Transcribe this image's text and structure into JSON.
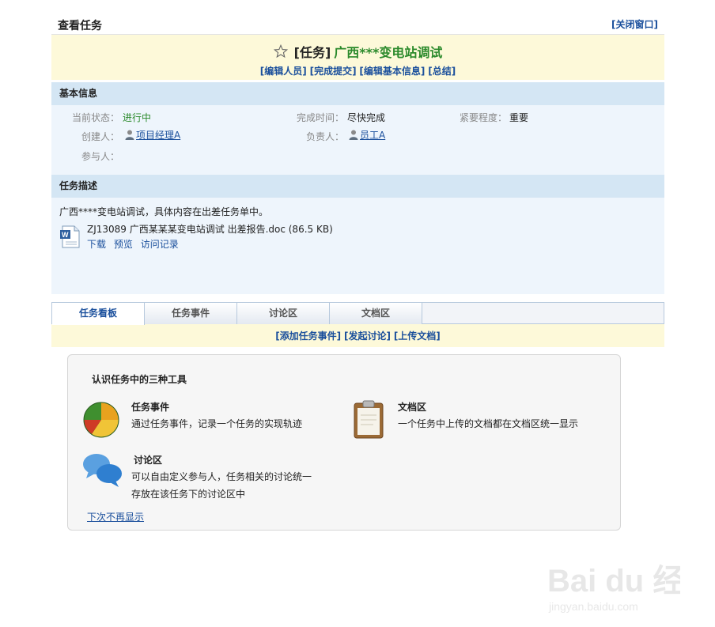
{
  "header": {
    "title": "查看任务",
    "close_label": "[关闭窗口]"
  },
  "task": {
    "type_label": "[任务]",
    "name": "广西***变电站调试",
    "actions": [
      "[编辑人员]",
      "[完成提交]",
      "[编辑基本信息]",
      "[总结]"
    ]
  },
  "basic_info": {
    "heading": "基本信息",
    "status_label": "当前状态：",
    "status_value": "进行中",
    "complete_label": "完成时间：",
    "complete_value": "尽快完成",
    "urgency_label": "紧要程度：",
    "urgency_value": "重要",
    "creator_label": "创建人：",
    "creator_value": "项目经理A",
    "owner_label": "负责人：",
    "owner_value": "员工A",
    "participants_label": "参与人："
  },
  "description": {
    "heading": "任务描述",
    "text": "广西****变电站调试，具体内容在出差任务单中。",
    "file_name": "ZJ13089 广西某某某变电站调试 出差报告.doc (86.5 KB)",
    "file_actions": [
      "下载",
      "预览",
      "访问记录"
    ]
  },
  "tabs": [
    "任务看板",
    "任务事件",
    "讨论区",
    "文档区"
  ],
  "tab_actions": [
    "[添加任务事件]",
    "[发起讨论]",
    "[上传文档]"
  ],
  "tools": {
    "heading": "认识任务中的三种工具",
    "event_title": "任务事件",
    "event_desc": "通过任务事件，记录一个任务的实现轨迹",
    "doc_title": "文档区",
    "doc_desc": "一个任务中上传的文档都在文档区统一显示",
    "discuss_title": "讨论区",
    "discuss_desc_1": "可以自由定义参与人，任务相关的讨论统一",
    "discuss_desc_2": "存放在该任务下的讨论区中",
    "no_show_label": "下次不再显示"
  },
  "watermark": {
    "text": "Bai du 经验",
    "url": "jingyan.baidu.com"
  },
  "colors": {
    "link": "#1a4f9c",
    "green": "#2b8a2b",
    "yellow_bg": "#fdf9d9",
    "section_bg": "#d4e6f4",
    "body_bg": "#eef5fc"
  }
}
